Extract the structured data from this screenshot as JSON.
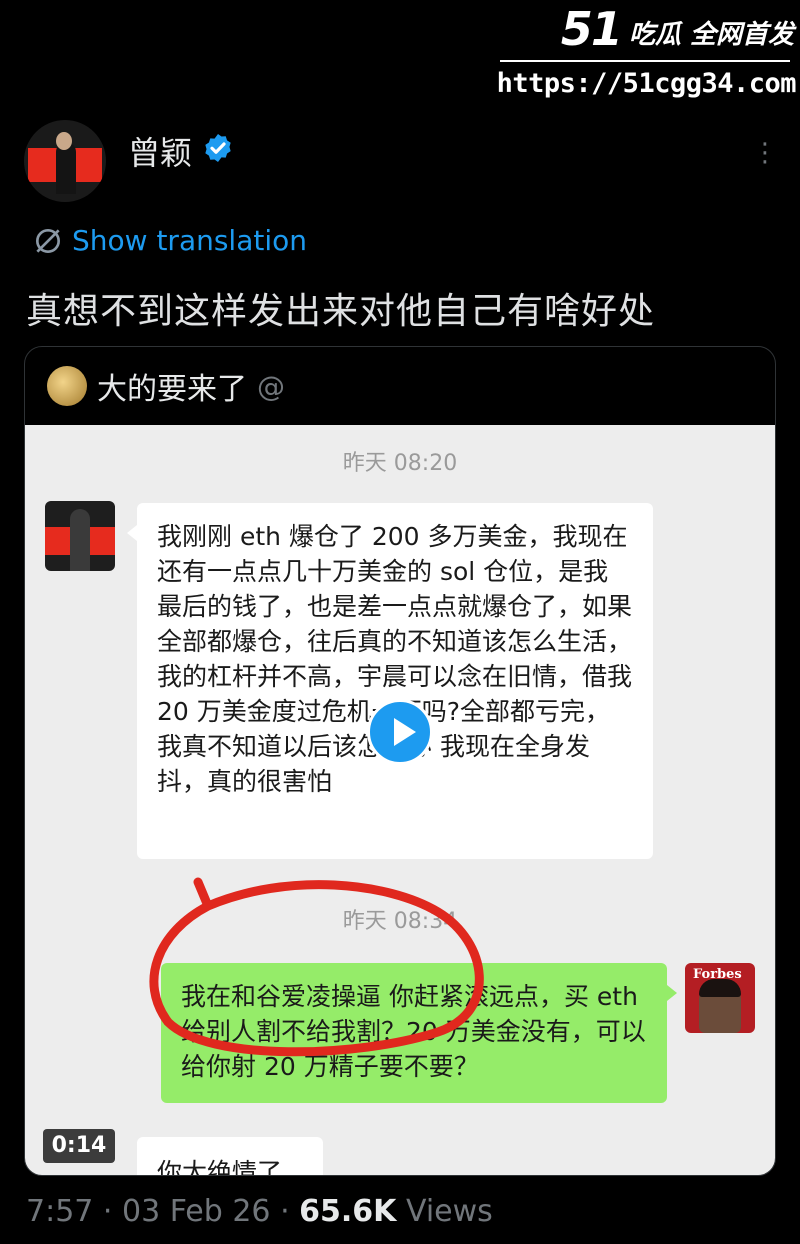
{
  "watermark": {
    "brand_number": "51",
    "brand_text": "吃瓜 全网首发",
    "url": "https://51cgg34.com"
  },
  "post": {
    "author_name": "曾颖",
    "verified": true,
    "show_translation": "Show translation",
    "text": "真想不到这样发出来对他自己有啥好处",
    "time": "7:57",
    "date": "03 Feb 26",
    "views_count": "65.6K",
    "views_label": "Views"
  },
  "quote": {
    "author_name": "大的要来了",
    "handle": "@"
  },
  "chat": {
    "time1": "昨天 08:20",
    "message1": "我刚刚 eth 爆仓了 200 多万美金，我现在还有一点点几十万美金的 sol 仓位，是我最后的钱了，也是差一点点就爆仓了，如果全部都爆仓，往后真的不知道该怎么生活，我的杠杆并不高，宇晨可以念在旧情，借我 20 万美金度过危机一下吗?全部都亏完，我真不知道以后该怎么办 我现在全身发抖，真的很害怕",
    "time2": "昨天 08:34",
    "message2": "我在和谷爱凌操逼 你赶紧滚远点，买 eth 给别人割不给我割？20 万美金没有，可以给你射 20 万精子要不要？",
    "message3": "你太绝情了",
    "video_duration": "0:14",
    "right_avatar_label": "Forbes"
  },
  "colors": {
    "accent": "#1d9bf0",
    "wechat_green": "#95ec69",
    "annotation_red": "#e0281e"
  }
}
